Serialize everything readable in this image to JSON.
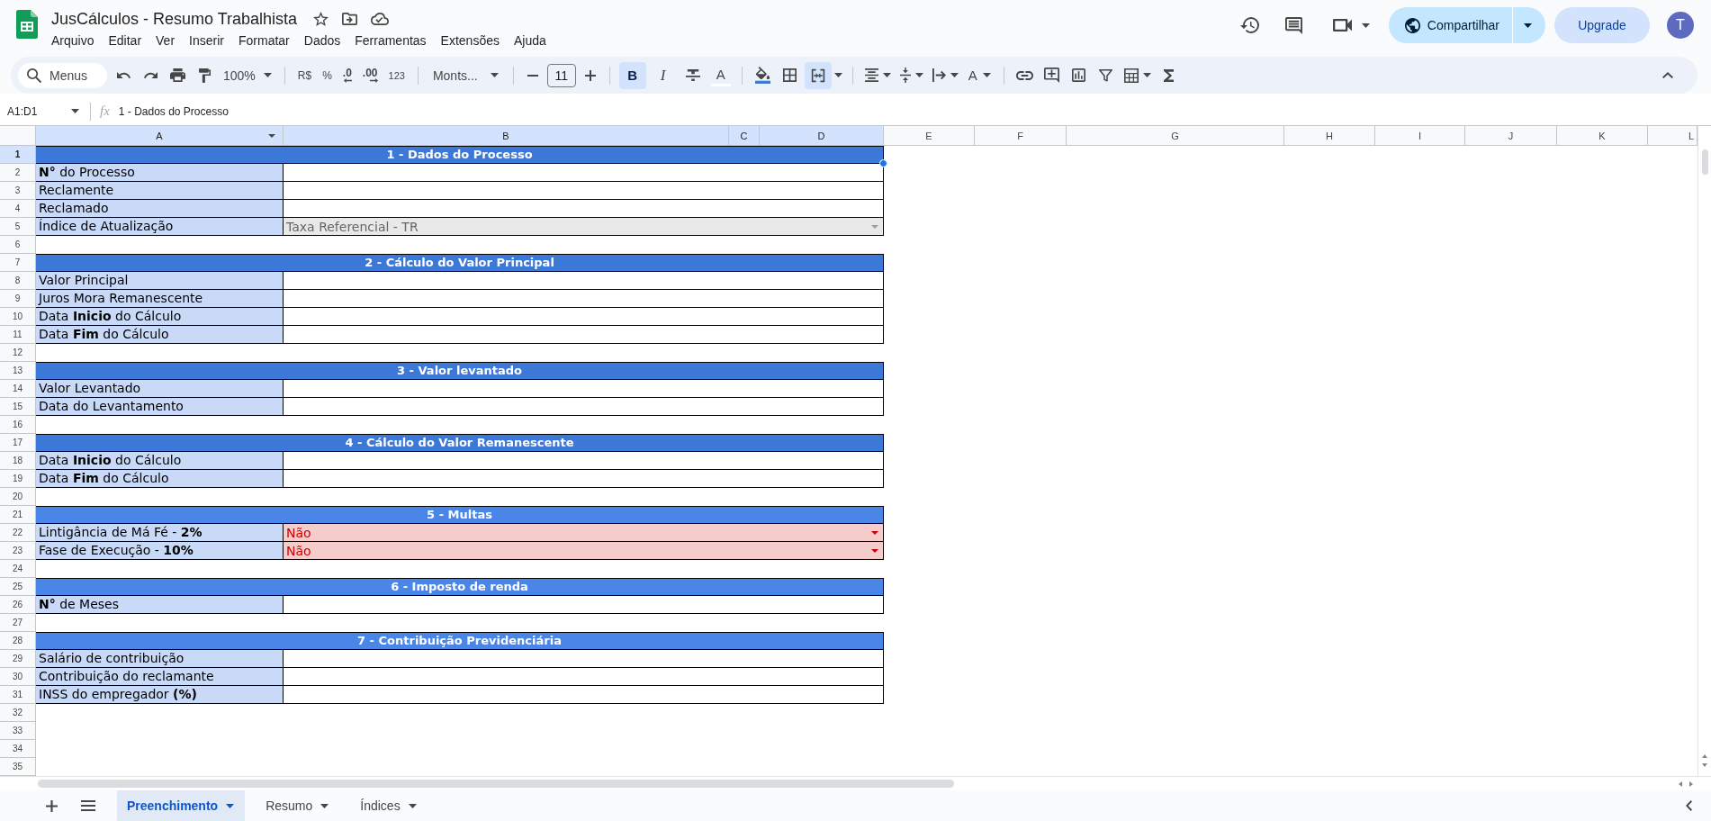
{
  "document": {
    "title": "JusCálculos - Resumo Trabalhista",
    "menu": [
      "Arquivo",
      "Editar",
      "Ver",
      "Inserir",
      "Formatar",
      "Dados",
      "Ferramentas",
      "Extensões",
      "Ajuda"
    ]
  },
  "header_actions": {
    "share_label": "Compartilhar",
    "upgrade_label": "Upgrade",
    "avatar_initial": "T"
  },
  "toolbar": {
    "search": {
      "label": "Menus"
    },
    "zoom": "100%",
    "currency": "R$",
    "percent": "%",
    "decimal_decrease": ".0",
    "decimal_increase": ".00",
    "number_format": "123",
    "font": "Monts...",
    "font_size": "11",
    "bold": {
      "label": "B",
      "on": true
    },
    "italic": {
      "label": "I",
      "on": false
    },
    "strikethrough": {
      "on": false
    },
    "text_color": {
      "label": "A"
    },
    "merge": {
      "on": true
    },
    "text_rotation": {
      "label": "A"
    }
  },
  "formula_bar": {
    "name_box": "A1:D1",
    "function_label": "fx",
    "content": "1 - Dados do Processo"
  },
  "sheet": {
    "columns": [
      {
        "label": "A",
        "selected": true,
        "dropdown": true
      },
      {
        "label": "B",
        "selected": true,
        "dropdown": false
      },
      {
        "label": "C",
        "selected": true,
        "dropdown": false
      },
      {
        "label": "D",
        "selected": true,
        "dropdown": false
      },
      {
        "label": "E",
        "selected": false,
        "dropdown": false
      },
      {
        "label": "F",
        "selected": false,
        "dropdown": false
      },
      {
        "label": "G",
        "selected": false,
        "dropdown": false
      },
      {
        "label": "H",
        "selected": false,
        "dropdown": false
      },
      {
        "label": "I",
        "selected": false,
        "dropdown": false
      },
      {
        "label": "J",
        "selected": false,
        "dropdown": false
      },
      {
        "label": "K",
        "selected": false,
        "dropdown": false
      },
      {
        "label": "L",
        "selected": false,
        "dropdown": false
      }
    ],
    "rows": [
      {
        "number": "1",
        "kind": "section",
        "title": "1 - Dados do Processo",
        "color": "#3c78d8",
        "selected": true
      },
      {
        "number": "2",
        "kind": "field",
        "label": "**N°** do Processo",
        "selected": false
      },
      {
        "number": "3",
        "kind": "field",
        "label": "Reclamente",
        "selected": false
      },
      {
        "number": "4",
        "kind": "field",
        "label": "Reclamado",
        "selected": false
      },
      {
        "number": "5",
        "kind": "select",
        "label": "Índice de Atualização",
        "value": "Taxa Referencial - TR",
        "alert": false,
        "selected": false
      },
      {
        "number": "6",
        "kind": "blank",
        "selected": false
      },
      {
        "number": "7",
        "kind": "section",
        "title": "2 - Cálculo do Valor Principal",
        "color": "#3c78d8",
        "selected": false
      },
      {
        "number": "8",
        "kind": "field",
        "label": "Valor Principal",
        "selected": false
      },
      {
        "number": "9",
        "kind": "field",
        "label": "Juros Mora Remanescente",
        "selected": false
      },
      {
        "number": "10",
        "kind": "field",
        "label": "Data **Inicio** do Cálculo",
        "selected": false
      },
      {
        "number": "11",
        "kind": "field",
        "label": "Data **Fim** do Cálculo",
        "selected": false
      },
      {
        "number": "12",
        "kind": "blank",
        "selected": false
      },
      {
        "number": "13",
        "kind": "section",
        "title": "3 - Valor levantado",
        "color": "#3c78d8",
        "selected": false
      },
      {
        "number": "14",
        "kind": "field",
        "label": "Valor Levantado",
        "selected": false
      },
      {
        "number": "15",
        "kind": "field",
        "label": "Data do Levantamento",
        "selected": false
      },
      {
        "number": "16",
        "kind": "blank",
        "selected": false
      },
      {
        "number": "17",
        "kind": "section",
        "title": "4 - Cálculo do Valor Remanescente",
        "color": "#3c78d8",
        "selected": false
      },
      {
        "number": "18",
        "kind": "field",
        "label": "Data **Inicio** do Cálculo",
        "selected": false
      },
      {
        "number": "19",
        "kind": "field",
        "label": "Data **Fim** do Cálculo",
        "selected": false
      },
      {
        "number": "20",
        "kind": "blank",
        "selected": false
      },
      {
        "number": "21",
        "kind": "section",
        "title": "5 - Multas",
        "color": "#4a86e8",
        "selected": false
      },
      {
        "number": "22",
        "kind": "select",
        "label": "Lintigância de Má Fé - **2%**",
        "value": "Não",
        "alert": true,
        "selected": false
      },
      {
        "number": "23",
        "kind": "select",
        "label": "Fase de Execução - **10%**",
        "value": "Não",
        "alert": true,
        "selected": false
      },
      {
        "number": "24",
        "kind": "blank",
        "selected": false
      },
      {
        "number": "25",
        "kind": "section",
        "title": "6 - Imposto de renda",
        "color": "#4a86e8",
        "selected": false
      },
      {
        "number": "26",
        "kind": "field",
        "label": "**N°** de Meses",
        "selected": false
      },
      {
        "number": "27",
        "kind": "blank",
        "selected": false
      },
      {
        "number": "28",
        "kind": "section",
        "title": "7 - Contribuição Previdenciária",
        "color": "#4a86e8",
        "selected": false
      },
      {
        "number": "29",
        "kind": "field",
        "label": "Salário de contribuição",
        "selected": false
      },
      {
        "number": "30",
        "kind": "field",
        "label": "Contribuição do reclamante",
        "selected": false
      },
      {
        "number": "31",
        "kind": "field",
        "label": "INSS do empregador **(%)**",
        "selected": false
      },
      {
        "number": "32",
        "kind": "blank",
        "selected": false
      },
      {
        "number": "33",
        "kind": "blank",
        "selected": false
      },
      {
        "number": "34",
        "kind": "blank",
        "selected": false
      },
      {
        "number": "35",
        "kind": "blank",
        "selected": false
      }
    ]
  },
  "sheet_tabs": [
    {
      "label": "Preenchimento",
      "selected": true
    },
    {
      "label": "Resumo",
      "selected": false
    },
    {
      "label": "Índices",
      "selected": false
    }
  ]
}
